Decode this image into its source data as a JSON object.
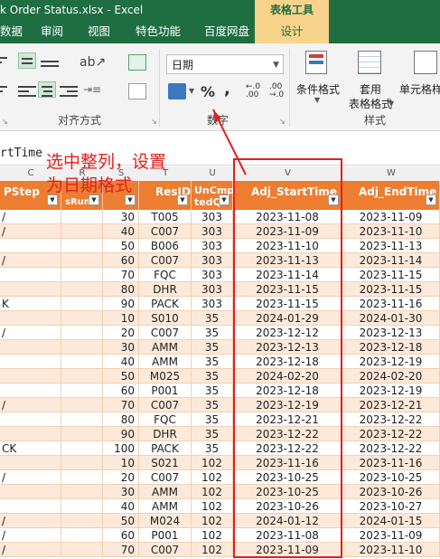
{
  "window": {
    "title": "k Order Status.xlsx - Excel",
    "context_tab_group": "表格工具"
  },
  "tabs": [
    {
      "label": "数据",
      "active": false
    },
    {
      "label": "审阅",
      "active": false
    },
    {
      "label": "视图",
      "active": false
    },
    {
      "label": "特色功能",
      "active": false
    },
    {
      "label": "百度网盘",
      "active": false
    },
    {
      "label": "设计",
      "active": true
    }
  ],
  "ribbon": {
    "alignment_group_label": "对齐方式",
    "number_group_label": "数字",
    "styles_group_label": "样式",
    "number_format_value": "日期",
    "percent_symbol": "%",
    "comma_symbol": ",",
    "conditional_format_label": "条件格式",
    "table_format_label_line1": "套用",
    "table_format_label_line2": "表格格式",
    "cell_style_label": "单元格样"
  },
  "formula_bar": {
    "text": "rtTime"
  },
  "column_letters": [
    "C",
    "R",
    "S",
    "T",
    "U",
    "V",
    "W"
  ],
  "table": {
    "headers": [
      "PStep",
      "sRun",
      "",
      "ResID",
      "UnCmp tedQt",
      "Adj_StartTime",
      "Adj_EndTime"
    ],
    "rows": [
      {
        "step": "/",
        "seq": "30",
        "res": "T005",
        "qty": "303",
        "start": "2023-11-08",
        "end": "2023-11-09"
      },
      {
        "step": "/",
        "seq": "40",
        "res": "C007",
        "qty": "303",
        "start": "2023-11-09",
        "end": "2023-11-10"
      },
      {
        "step": "",
        "seq": "50",
        "res": "B006",
        "qty": "303",
        "start": "2023-11-10",
        "end": "2023-11-13"
      },
      {
        "step": "/",
        "seq": "60",
        "res": "C007",
        "qty": "303",
        "start": "2023-11-13",
        "end": "2023-11-14"
      },
      {
        "step": "",
        "seq": "70",
        "res": "FQC",
        "qty": "303",
        "start": "2023-11-14",
        "end": "2023-11-15"
      },
      {
        "step": "",
        "seq": "80",
        "res": "DHR",
        "qty": "303",
        "start": "2023-11-15",
        "end": "2023-11-15"
      },
      {
        "step": "K",
        "seq": "90",
        "res": "PACK",
        "qty": "303",
        "start": "2023-11-15",
        "end": "2023-11-16"
      },
      {
        "step": "",
        "seq": "10",
        "res": "S010",
        "qty": "35",
        "start": "2024-01-29",
        "end": "2024-01-30"
      },
      {
        "step": "/",
        "seq": "20",
        "res": "C007",
        "qty": "35",
        "start": "2023-12-12",
        "end": "2023-12-13"
      },
      {
        "step": "",
        "seq": "30",
        "res": "AMM",
        "qty": "35",
        "start": "2023-12-13",
        "end": "2023-12-18"
      },
      {
        "step": "",
        "seq": "40",
        "res": "AMM",
        "qty": "35",
        "start": "2023-12-18",
        "end": "2023-12-19"
      },
      {
        "step": "",
        "seq": "50",
        "res": "M025",
        "qty": "35",
        "start": "2024-02-20",
        "end": "2024-02-20"
      },
      {
        "step": "",
        "seq": "60",
        "res": "P001",
        "qty": "35",
        "start": "2023-12-18",
        "end": "2023-12-19"
      },
      {
        "step": "/",
        "seq": "70",
        "res": "C007",
        "qty": "35",
        "start": "2023-12-19",
        "end": "2023-12-21"
      },
      {
        "step": "",
        "seq": "80",
        "res": "FQC",
        "qty": "35",
        "start": "2023-12-21",
        "end": "2023-12-22"
      },
      {
        "step": "",
        "seq": "90",
        "res": "DHR",
        "qty": "35",
        "start": "2023-12-22",
        "end": "2023-12-22"
      },
      {
        "step": "CK",
        "seq": "100",
        "res": "PACK",
        "qty": "35",
        "start": "2023-12-22",
        "end": "2023-12-22"
      },
      {
        "step": "",
        "seq": "10",
        "res": "S021",
        "qty": "102",
        "start": "2023-11-16",
        "end": "2023-11-16"
      },
      {
        "step": "/",
        "seq": "20",
        "res": "C007",
        "qty": "102",
        "start": "2023-10-25",
        "end": "2023-10-25"
      },
      {
        "step": "",
        "seq": "30",
        "res": "AMM",
        "qty": "102",
        "start": "2023-10-25",
        "end": "2023-10-26"
      },
      {
        "step": "",
        "seq": "40",
        "res": "AMM",
        "qty": "102",
        "start": "2023-10-26",
        "end": "2023-10-27"
      },
      {
        "step": "/",
        "seq": "50",
        "res": "M024",
        "qty": "102",
        "start": "2024-01-12",
        "end": "2024-01-15"
      },
      {
        "step": "/",
        "seq": "60",
        "res": "P001",
        "qty": "102",
        "start": "2023-11-08",
        "end": "2023-11-09"
      },
      {
        "step": "/",
        "seq": "70",
        "res": "C007",
        "qty": "102",
        "start": "2023-11-09",
        "end": "2023-11-10"
      }
    ]
  },
  "annotation": {
    "line1": "选中整列，设置",
    "line2": "为日期格式"
  },
  "colors": {
    "excel_green": "#1e6e41",
    "header_orange": "#ed7d31",
    "band_light": "#fde9d9",
    "annotation_red": "#e02020"
  }
}
